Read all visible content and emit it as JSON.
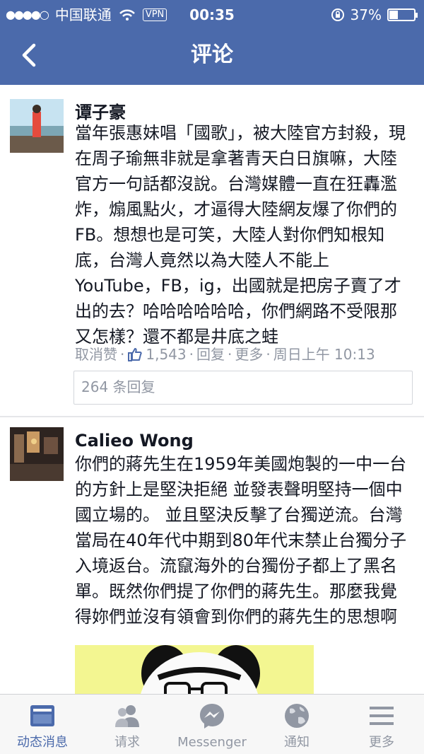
{
  "status_bar": {
    "carrier": "中国联通",
    "vpn": "VPN",
    "time": "00:35",
    "battery": "37%",
    "battery_level": 0.37
  },
  "nav": {
    "title": "评论"
  },
  "comments": [
    {
      "author": "谭子豪",
      "text": "當年張惠妹唱「國歌」，被大陸官方封殺，現在周子瑜無非就是拿著青天白日旗嘛，大陸官方一句話都沒說。台灣媒體一直在狂轟濫炸，煽風點火，才逼得大陸網友爆了你們的FB。想想也是可笑，大陸人對你們知根知底，台灣人竟然以為大陸人不能上YouTube，FB，ig，出國就是把房子賣了才出的去？哈哈哈哈哈哈，你們網路不受限那又怎樣？還不都是井底之蛙",
      "unlike": "取消赞",
      "likes": "1,543",
      "reply": "回复",
      "more": "更多",
      "time": "周日上午 10:13",
      "replies": "264 条回复"
    },
    {
      "author": "Calieo Wong",
      "text": "你們的蔣先生在1959年美國炮製的一中一台的方針上是堅決拒絕 並發表聲明堅持一個中國立場的。 並且堅決反擊了台獨逆流。台灣當局在40年代中期到80年代末禁止台獨分子入境返台。流竄海外的台獨份子都上了黑名單。既然你們提了你們的蔣先生。那麼我覺得妳們並沒有領會到你們的蔣先生的思想啊"
    }
  ],
  "tabs": [
    {
      "label": "动态消息",
      "icon": "news-feed-icon"
    },
    {
      "label": "请求",
      "icon": "friend-requests-icon"
    },
    {
      "label": "Messenger",
      "icon": "messenger-icon"
    },
    {
      "label": "通知",
      "icon": "globe-icon"
    },
    {
      "label": "更多",
      "icon": "menu-icon"
    }
  ],
  "colors": {
    "brand": "#4b6aab",
    "meta": "#9197a3",
    "sticker_bg": "#f3f691"
  }
}
